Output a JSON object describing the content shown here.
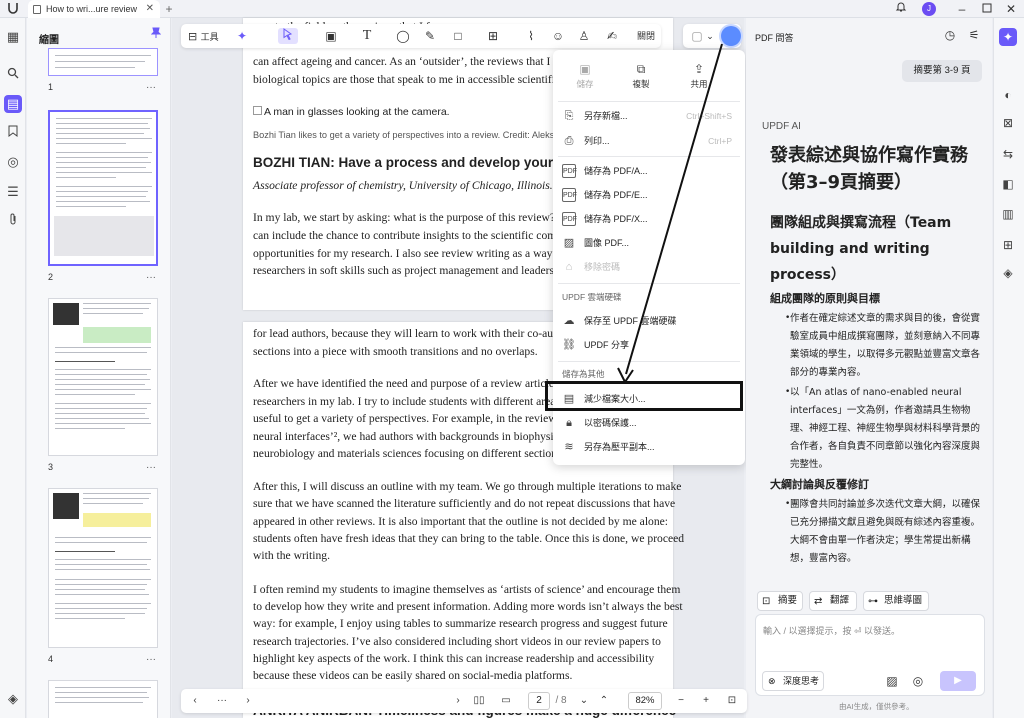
{
  "titlebar": {
    "tab_title": "How to wri...ure review",
    "tab_close": "✕",
    "new_tab": "+",
    "avatar_initial": "J"
  },
  "thumbnails": {
    "title": "縮圖",
    "pages": [
      "1",
      "2",
      "3",
      "4"
    ],
    "more": "···"
  },
  "toolbar": {
    "tools_label": "工具",
    "close_label": "關閉"
  },
  "doc_top": {
    "lines": [
      "new to the field, ... the reviews that I f...",
      "can affect ageing and cancer. As an ‘outsider’, the reviews that I find",
      "biological topics are those that speak to me in accessible scientific l"
    ],
    "image_alt": "A man in glasses looking at the camera.",
    "caption": "Bozhi Tian likes to get a variety of perspectives into a review.  Credit: Aleksan",
    "heading": "BOZHI TIAN: Have a process and develop your sty",
    "subtitle": "Associate professor of chemistry, University of Chicago, Illinois.",
    "para": [
      "In my lab, we start by asking: what is the purpose of this review? My",
      "can include the chance to contribute insights to the scientific comm",
      "opportunities for my research. I also see review writing as a way to t",
      "researchers in soft skills such as project management and leadershi"
    ]
  },
  "doc_bottom": {
    "p1": [
      "for lead authors, because they will learn to work with their co-autho",
      "sections into a piece with smooth transitions and no overlaps."
    ],
    "p2": [
      "After we have identified the need and purpose of a review article, I",
      "researchers in my lab. I try to include students with different areas",
      "useful to get a variety of perspectives. For example, in the review ‘A",
      "neural interfaces’², we had authors with backgrounds in biophysics,",
      "neurobiology and materials sciences focusing on different sections."
    ],
    "p3": [
      "After this, I will discuss an outline with my team. We go through multiple iterations to make",
      "sure that we have scanned the literature sufficiently and do not repeat discussions that have",
      "appeared in other reviews. It is also important that the outline is not decided by me alone:",
      "students often have fresh ideas that they can bring to the table. Once this is done, we proceed",
      "with the writing."
    ],
    "p4": [
      "I often remind my students to imagine themselves as ‘artists of science’ and encourage them",
      "to develop how they write and present information. Adding more words isn’t always the best",
      "way: for example, I enjoy using tables to summarize research progress and suggest future",
      "research trajectories. I’ve also considered including short videos in our review papers to",
      "highlight key aspects of the work. I think this can increase readership and accessibility",
      "because these videos can be easily shared on social-media platforms."
    ],
    "heading": "ANKITA ANIRBAN: Timeliness and figures make a huge difference"
  },
  "menu": {
    "grid": [
      "儲存",
      "複製",
      "共用"
    ],
    "items": [
      {
        "label": "另存新檔...",
        "shortcut": "Ctrl+Shift+S"
      },
      {
        "label": "列印...",
        "shortcut": "Ctrl+P"
      },
      {
        "label": "儲存為 PDF/A..."
      },
      {
        "label": "儲存為 PDF/E..."
      },
      {
        "label": "儲存為 PDF/X..."
      },
      {
        "label": "圖像 PDF..."
      },
      {
        "label": "移除密碼"
      }
    ],
    "cloud_header": "UPDF 雲端硬碟",
    "cloud_items": [
      "保存至 UPDF 雲端硬碟",
      "UPDF 分享"
    ],
    "other_header": "儲存為其他",
    "other_items": [
      "減少檔案大小...",
      "以密碼保護...",
      "另存為壓平副本..."
    ]
  },
  "right_panel": {
    "title": "PDF 問答",
    "summary_pill": "摘要第 3-9 頁",
    "ai_label": "UPDF AI",
    "h1": "發表綜述與協作寫作實務（第3–9頁摘要）",
    "h2": "團隊組成與撰寫流程（Team building and writing process）",
    "h3a": "組成團隊的原則與目標",
    "b1": "作者在確定綜述文章的需求與目的後，會從實驗室成員中組成撰寫團隊，並刻意納入不同專業領域的學生，以取得多元觀點並豐富文章各部分的專業內容。",
    "b2": "以「An atlas of nano-enabled neural interfaces」一文為例，作者邀請具生物物理、神經工程、神經生物學與材料科學背景的合作者，各自負責不同章節以強化內容深度與完整性。",
    "h3b": "大綱討論與反覆修訂",
    "b3": "團隊會共同討論並多次迭代文章大綱，以確保已充分掃描文獻且避免與既有綜述內容重複。大綱不會由單一作者決定；學生常提出新構想，豐富內容。",
    "actions": [
      "摘要",
      "翻譯",
      "思維導圖"
    ],
    "placeholder": "輸入 / 以選擇提示，按 ⏎ 以發送。",
    "deep_label": "深度思考",
    "send": "▶",
    "footnote": "由AI生成，僅供參考。"
  },
  "bottombar": {
    "page_current": "2",
    "page_total": "/ 8",
    "zoom": "82%"
  }
}
